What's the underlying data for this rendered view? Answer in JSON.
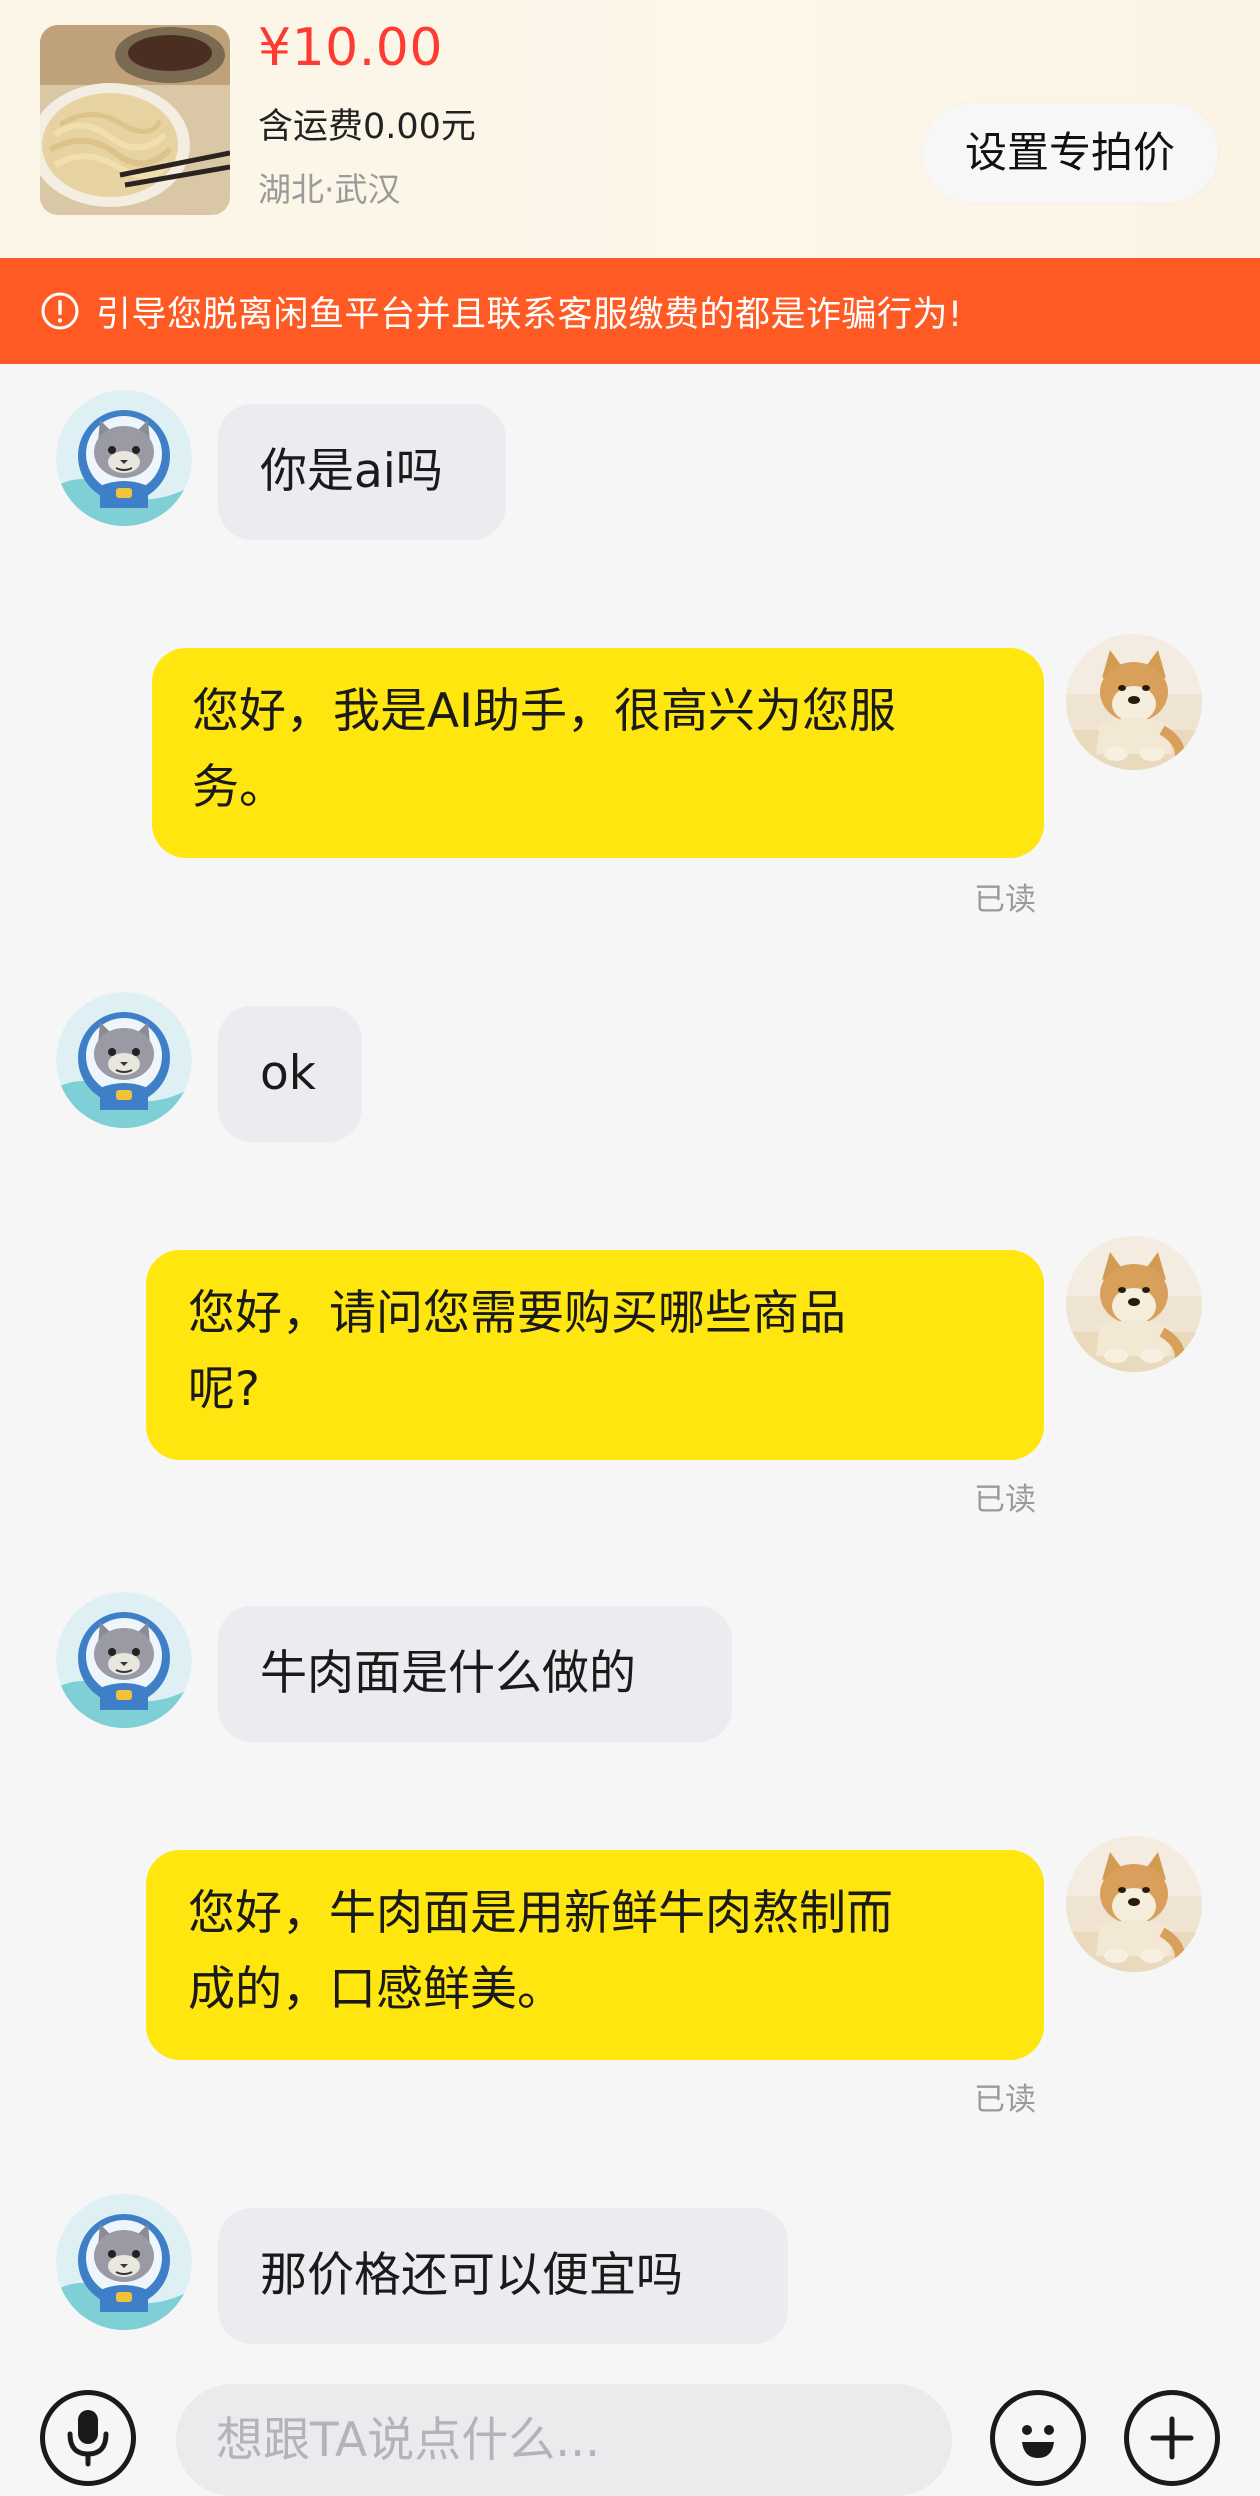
{
  "product": {
    "thumbnail_icon": "beef-noodle-photo",
    "price": "¥10.00",
    "shipping": "含运费0.00元",
    "location": "湖北·武汉",
    "set_price_label": "设置专拍价"
  },
  "warning": {
    "icon": "exclamation-circle-icon",
    "text": "引导您脱离闲鱼平台并且联系客服缴费的都是诈骗行为!",
    "color": "#ff5a23"
  },
  "messages": [
    {
      "sender": "buyer",
      "text": "你是ai吗"
    },
    {
      "sender": "seller",
      "lines": [
        "您好，我是AI助手，很高兴为您服",
        "务。"
      ],
      "status": "已读"
    },
    {
      "sender": "buyer",
      "text": "ok"
    },
    {
      "sender": "seller",
      "lines": [
        "您好，请问您需要购买哪些商品",
        "呢?"
      ],
      "status": "已读"
    },
    {
      "sender": "buyer",
      "text": "牛肉面是什么做的"
    },
    {
      "sender": "seller",
      "lines": [
        "您好，牛肉面是用新鲜牛肉熬制而",
        "成的，口感鲜美。"
      ],
      "status": "已读"
    },
    {
      "sender": "buyer",
      "text": "那价格还可以便宜吗"
    }
  ],
  "avatars": {
    "buyer_icon": "cat-astronaut-avatar",
    "seller_icon": "shiba-inu-avatar"
  },
  "input_bar": {
    "voice_icon": "microphone-icon",
    "placeholder": "想跟TA说点什么...",
    "emoji_icon": "emoji-icon",
    "more_icon": "plus-icon"
  },
  "colors": {
    "price": "#ff3a30",
    "outgoing_bubble": "#ffe60f",
    "incoming_bubble": "#ecebef"
  }
}
